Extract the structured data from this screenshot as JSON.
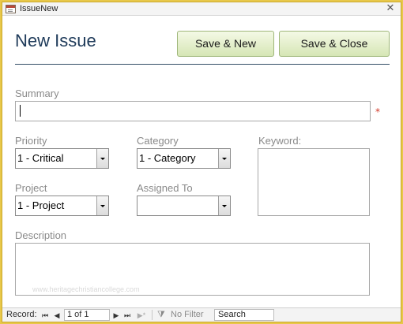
{
  "window": {
    "title": "IssueNew",
    "close_glyph": "✕"
  },
  "form": {
    "heading": "New Issue",
    "save_new_label": "Save & New",
    "save_close_label": "Save & Close",
    "summary": {
      "label": "Summary",
      "value": "",
      "required_marker": "*"
    },
    "priority": {
      "label": "Priority",
      "value": "1 - Critical"
    },
    "category": {
      "label": "Category",
      "value": "1 - Category"
    },
    "keyword": {
      "label": "Keyword:"
    },
    "project": {
      "label": "Project",
      "value": "1 - Project"
    },
    "assigned_to": {
      "label": "Assigned To",
      "value": ""
    },
    "description": {
      "label": "Description"
    },
    "watermark": "www.heritagechristiancollege.com"
  },
  "navigation": {
    "record_label": "Record:",
    "position": "1 of 1",
    "first_glyph": "⏮",
    "prev_glyph": "◀",
    "next_glyph": "▶",
    "last_glyph": "⏭",
    "new_glyph": "▶*",
    "filter_label": "No Filter",
    "search_text": "Search"
  }
}
